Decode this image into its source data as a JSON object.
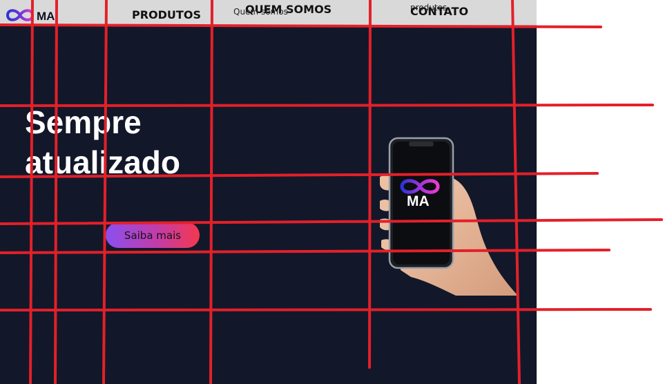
{
  "navbar": {
    "logo_text": "MA",
    "links": [
      {
        "label": "PRODUTOS"
      },
      {
        "label": "QUEM SOMOS"
      },
      {
        "label": "CONTATO"
      }
    ],
    "overlapping_text": [
      "Quem somos",
      "produtos"
    ]
  },
  "hero": {
    "title_line1": "Sempre",
    "title_line2": "atualizado",
    "cta_label": "Saiba mais",
    "phone_logo_text": "MA"
  },
  "colors": {
    "page_background": "#121829",
    "navbar_background": "#d9d9d9",
    "cta_gradient_start": "#8a4ff0",
    "cta_gradient_end": "#f4374f",
    "guide_lines": "#e3202a"
  },
  "icons": [
    "infinity-logo-icon",
    "phone-illustration"
  ]
}
